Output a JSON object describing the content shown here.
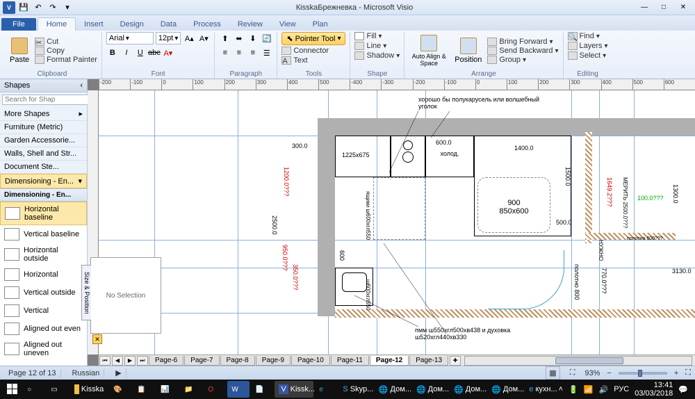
{
  "app": {
    "title": "КisskaБрежневка - Microsoft Visio"
  },
  "qat": {
    "save": "💾",
    "undo": "↶",
    "redo": "↷"
  },
  "tabs": {
    "file": "File",
    "home": "Home",
    "insert": "Insert",
    "design": "Design",
    "data": "Data",
    "process": "Process",
    "review": "Review",
    "view": "View",
    "plan": "Plan"
  },
  "ribbon": {
    "clipboard": {
      "label": "Clipboard",
      "paste": "Paste",
      "cut": "Cut",
      "copy": "Copy",
      "format_painter": "Format Painter"
    },
    "font": {
      "label": "Font",
      "name": "Arial",
      "size": "12pt",
      "bold": "B",
      "italic": "I",
      "underline": "U",
      "strike": "abc"
    },
    "paragraph": {
      "label": "Paragraph"
    },
    "tools": {
      "label": "Tools",
      "pointer": "Pointer Tool",
      "connector": "Connector",
      "text": "Text"
    },
    "shape": {
      "label": "Shape",
      "fill": "Fill",
      "line": "Line",
      "shadow": "Shadow"
    },
    "arrange": {
      "label": "Arrange",
      "autoalign": "Auto Align & Space",
      "position": "Position",
      "bring_forward": "Bring Forward",
      "send_backward": "Send Backward",
      "group": "Group"
    },
    "editing": {
      "label": "Editing",
      "find": "Find",
      "layers": "Layers",
      "select": "Select"
    }
  },
  "shapes_pane": {
    "title": "Shapes",
    "search_placeholder": "Search for Shap",
    "more_shapes": "More Shapes",
    "stencils": [
      "Furniture (Metric)",
      "Garden Accessorie...",
      "Walls, Shell and Str...",
      "Document Ste...",
      "Dimensioning - En..."
    ],
    "active_stencil": "Dimensioning - En...",
    "shapes": [
      "Horizontal baseline",
      "Vertical baseline",
      "Horizontal outside",
      "Horizontal",
      "Vertical outside",
      "Vertical",
      "Aligned out even",
      "Aligned out uneven"
    ]
  },
  "sizepos": {
    "tab": "Size & Position",
    "body": "No Selection"
  },
  "ruler_h": [
    "-200",
    "-100",
    "0",
    "100",
    "200",
    "300",
    "400",
    "500",
    "-400",
    "-300",
    "-200",
    "-100",
    "0",
    "100",
    "200",
    "300",
    "400",
    "500",
    "600"
  ],
  "pages": {
    "list": [
      "Page-6",
      "Page-7",
      "Page-8",
      "Page-9",
      "Page-10",
      "Page-11",
      "Page-12",
      "Page-13"
    ],
    "active_index": 6
  },
  "status": {
    "page": "Page 12 of 13",
    "lang": "Russian",
    "zoom": "93%"
  },
  "taskbar": {
    "items": [
      "Kisska",
      "",
      "",
      "",
      "",
      "",
      "",
      "",
      "Kissk...",
      "",
      "Skyp...",
      "Дом...",
      "Дом...",
      "Дом...",
      "Дом...",
      "кухн..."
    ],
    "tray_lang": "РУС",
    "clock_time": "13:41",
    "clock_date": "03/03/2018"
  },
  "drawing": {
    "note_top": "хорошо бы полукарусель или волшебный уголок",
    "note_bottom": "пмм ш550хгл500хв438 и духовка ш520хгл440хв330",
    "dims": {
      "d1225": "1225x675",
      "d600a": "600.0",
      "d1400": "1400.0",
      "fridge": "холод.",
      "d900": "900",
      "d850": "850x600",
      "d500": "500.0",
      "d300": "300.0",
      "d2500": "2500.0",
      "d1200r": "1200.0???",
      "d950r": "950.0???",
      "d350r": "350.0???",
      "d600b": "600",
      "draw": "ящики ш600хгл550",
      "sink": "ш600хгл550",
      "d1500": "1500.0",
      "d1300": "1300.0",
      "d3130": "3130.0",
      "d1649r": "1649.2???",
      "d100g": "100.0???",
      "door": "полотно 800",
      "d770": "770.0???",
      "merit": "МЕРИТЬ 2500.0???",
      "nuzno": "НУЖНО",
      "polotno600": "полотно 600???"
    }
  }
}
